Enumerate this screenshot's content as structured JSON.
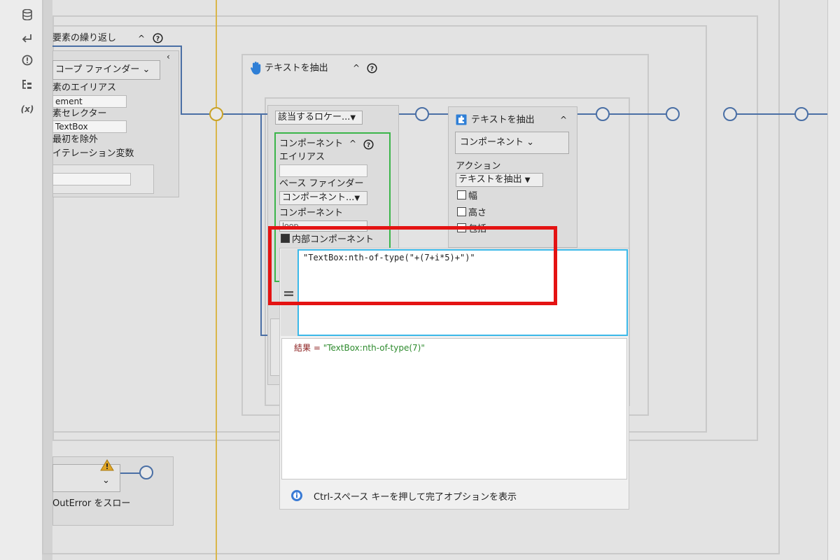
{
  "sidebar": {
    "icons": [
      "database-icon",
      "enter-icon",
      "alert-icon",
      "tree-icon",
      "variable-icon"
    ],
    "variable_label": "(x)"
  },
  "loop": {
    "title": "要素の繰り返し",
    "scope_finder": "コープ ファインダー",
    "alias_label": "素のエイリアス",
    "alias_value": "ement",
    "selector_label": "素セレクター",
    "selector_value": "TextBox",
    "exclude_first": "最初を除外",
    "iteration_var": "イテレーション変数"
  },
  "extract": {
    "title": "テキストを抽出"
  },
  "locator": {
    "selected": "該当するロケー...",
    "component_title": "コンポーネント",
    "alias_label": "エイリアス",
    "base_finder_label": "ベース ファインダー",
    "base_finder_value": "コンポーネント...",
    "component_label": "コンポーネント",
    "component_value": "loop",
    "inner_component": "内部コンポーネント"
  },
  "extract_card": {
    "title": "テキストを抽出",
    "component": "コンポーネント",
    "action_label": "アクション",
    "action_value": "テキストを抽出",
    "width": "幅",
    "height": "高さ",
    "include": "包括"
  },
  "throw": {
    "label": "OutError をスロー"
  },
  "editor": {
    "expression": "\"TextBox:nth-of-type(\"+(7+i*5)+\")\"",
    "result_prefix": "結果 = ",
    "result_value": "\"TextBox:nth-of-type(7)\"",
    "hint": "Ctrl-スペース キーを押して完了オプションを表示"
  },
  "colors": {
    "wire": "#4a6fa5",
    "highlight": "#e41313",
    "editor_border": "#3bb8e8",
    "result_value": "#2e8b2e",
    "result_key": "#8b1e1e",
    "guide_line": "#d9b64a"
  }
}
